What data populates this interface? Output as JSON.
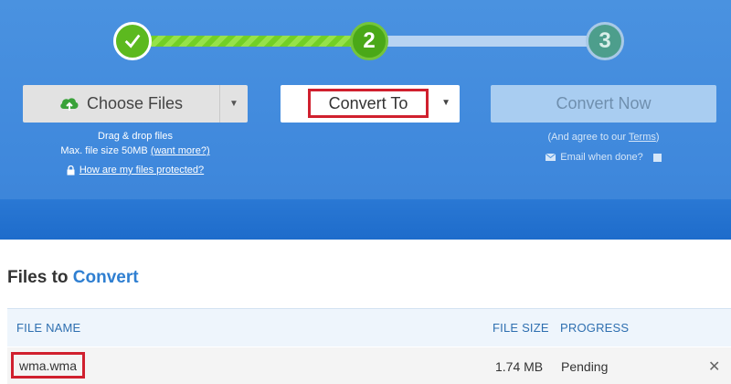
{
  "steps": {
    "step2_number": "2",
    "step3_number": "3"
  },
  "choose_files": {
    "label": "Choose Files",
    "drag_text": "Drag & drop files",
    "max_size_text": "Max. file size 50MB",
    "want_more_link": "(want more?)",
    "protected_link": "How are my files protected?"
  },
  "convert_to": {
    "label": "Convert To"
  },
  "convert_now": {
    "label": "Convert Now",
    "agree_prefix": "(And agree to our ",
    "terms_link": "Terms",
    "agree_suffix": ")",
    "email_label": "Email when done?"
  },
  "files_section": {
    "title_prefix": "Files to",
    "title_accent": "Convert"
  },
  "table": {
    "headers": {
      "name": "FILE NAME",
      "size": "FILE SIZE",
      "progress": "PROGRESS"
    },
    "rows": [
      {
        "name": "wma.wma",
        "size": "1.74 MB",
        "status": "Pending",
        "remove": "✕"
      }
    ]
  },
  "colors": {
    "hero_blue": "#4a92e0",
    "step_green": "#5cb91f",
    "highlight_red": "#d0202e",
    "accent_blue": "#2f7fd1"
  },
  "icons": {
    "step1": "checkmark-icon",
    "choose": "cloud-upload-icon",
    "caret": "caret-down-icon",
    "protected": "lock-icon",
    "email": "envelope-icon",
    "remove": "close-icon"
  }
}
